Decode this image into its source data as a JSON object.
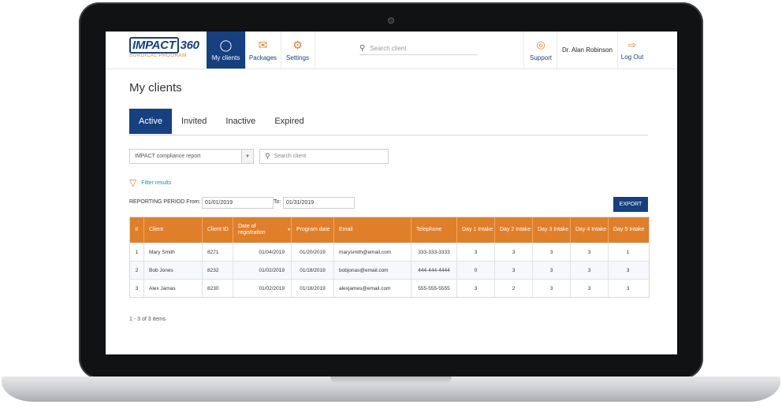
{
  "header": {
    "logo_brand": "IMPACT",
    "logo_number": "360",
    "logo_sub": "SURGICAL PROGRAM",
    "nav": [
      {
        "label": "My clients",
        "icon": "user-icon"
      },
      {
        "label": "Packages",
        "icon": "mail-icon"
      },
      {
        "label": "Settings",
        "icon": "gear-icon"
      }
    ],
    "search_placeholder": "Search client",
    "support_label": "Support",
    "user_name": "Dr. Alan Robinson",
    "logout_label": "Log Out"
  },
  "page": {
    "title": "My clients",
    "tabs": [
      "Active",
      "Invited",
      "Inactive",
      "Expired"
    ],
    "active_tab": "Active"
  },
  "filters": {
    "report_select": "IMPACT compliance report",
    "search_placeholder": "Search client",
    "filter_link": "Filter results",
    "period_label": "REPORTING PERIOD From:",
    "date_from": "01/01/2019",
    "to_label": "To:",
    "date_to": "01/31/2019",
    "export_label": "EXPORT"
  },
  "table": {
    "headers": [
      "#",
      "Client",
      "Client ID",
      "Date of registration",
      "Program date",
      "Email",
      "Telephone",
      "Day 1 Intake",
      "Day 2 Intake",
      "Day 3 Intake",
      "Day 4 Intake",
      "Day 5 Intake"
    ],
    "rows": [
      [
        "1",
        "Mary Smith",
        "8271",
        "01/04/2019",
        "01/20/2019",
        "marysmith@email.com",
        "333-333-3333",
        "3",
        "3",
        "3",
        "3",
        "1"
      ],
      [
        "2",
        "Bob Jones",
        "8232",
        "01/02/2019",
        "01/18/2019",
        "bobjonas@email.com",
        "444-444-4444",
        "0",
        "3",
        "3",
        "3",
        "3"
      ],
      [
        "3",
        "Alex Jamas",
        "8230",
        "01/02/2019",
        "01/18/2019",
        "alexjames@email.com",
        "555-555-5555",
        "3",
        "2",
        "3",
        "3",
        "3"
      ]
    ],
    "pager": "1 - 3 of 3 items"
  },
  "colors": {
    "brand_blue": "#16407f",
    "accent_orange": "#e07f2a",
    "link_teal": "#1f8fb5"
  }
}
